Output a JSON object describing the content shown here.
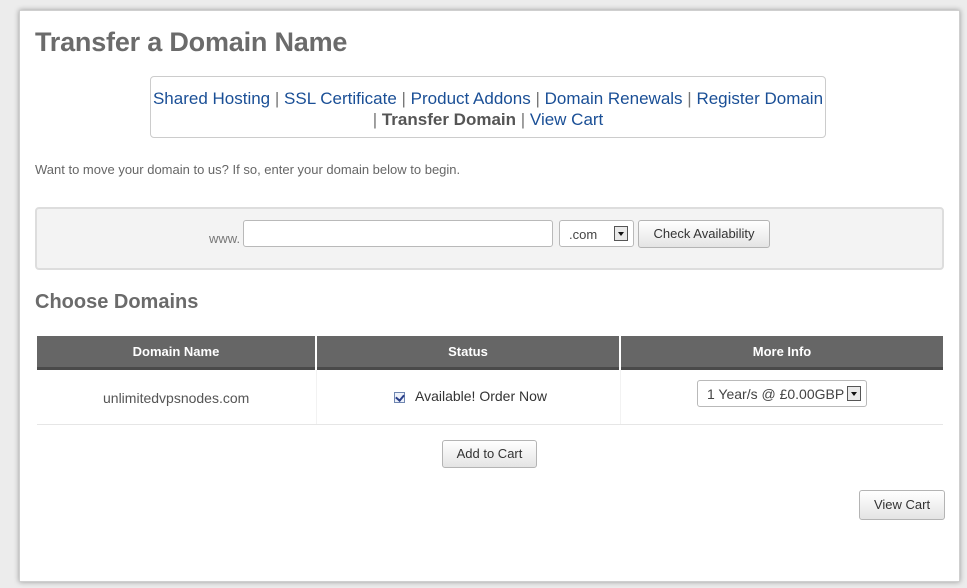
{
  "page": {
    "title": "Transfer a Domain Name"
  },
  "nav": {
    "shared_hosting": "Shared Hosting",
    "ssl_certificate": "SSL Certificate",
    "product_addons": "Product Addons",
    "domain_renewals": "Domain Renewals",
    "register_domain": "Register Domain",
    "transfer_domain": "Transfer Domain",
    "view_cart": "View Cart",
    "separator": "|"
  },
  "intro_text": "Want to move your domain to us? If so, enter your domain below to begin.",
  "search": {
    "prefix": "www.",
    "domain_value": "",
    "tld_selected": ".com",
    "check_button": "Check Availability"
  },
  "choose": {
    "title": "Choose Domains",
    "columns": [
      "Domain Name",
      "Status",
      "More Info"
    ],
    "rows": [
      {
        "domain": "unlimitedvpsnodes.com",
        "checked": true,
        "status": "Available! Order Now",
        "term": "1 Year/s @ £0.00GBP"
      }
    ],
    "add_to_cart": "Add to Cart",
    "view_cart": "View Cart"
  },
  "colors": {
    "link": "#1a4f96",
    "header_bg": "#666666",
    "title": "#6b6b6b"
  },
  "icons": {
    "dropdown": "chevron-down-icon",
    "checkbox": "checkmark-icon"
  }
}
